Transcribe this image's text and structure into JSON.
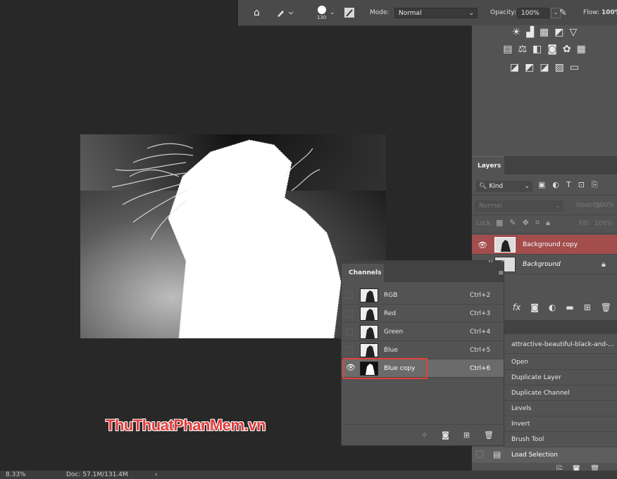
{
  "options_bar": {
    "brush_size": "130",
    "mode_label": "Mode:",
    "mode_value": "Normal",
    "opacity_label": "Opacity:",
    "opacity_value": "100%",
    "flow_label": "Flow:",
    "flow_value": "100%"
  },
  "layers": {
    "tab": "Layers",
    "filter_kind": "Kind",
    "blend_mode": "Normal",
    "opacity_label": "Opacity:",
    "opacity_value": "100%",
    "lock_label": "Lock:",
    "fill_label": "Fill:",
    "fill_value": "100%",
    "items": [
      {
        "name": "Background copy"
      },
      {
        "name": "Background"
      }
    ]
  },
  "channels": {
    "title": "Channels",
    "items": [
      {
        "name": "RGB",
        "shortcut": "Ctrl+2"
      },
      {
        "name": "Red",
        "shortcut": "Ctrl+3"
      },
      {
        "name": "Green",
        "shortcut": "Ctrl+4"
      },
      {
        "name": "Blue",
        "shortcut": "Ctrl+5"
      },
      {
        "name": "Blue copy",
        "shortcut": "Ctrl+6"
      }
    ]
  },
  "history": {
    "snapshot": "attractive-beautiful-black-and-...",
    "items": [
      "Open",
      "Duplicate Layer",
      "Duplicate Channel",
      "Levels",
      "Invert",
      "Brush Tool",
      "Load Selection"
    ]
  },
  "watermark": "ThuThuatPhanMem.vn",
  "status": {
    "zoom": "8.33%",
    "doc": "Doc: 57.1M/131.4M"
  },
  "colors": {
    "highlight": "#e0413a",
    "selected_layer": "#a34d4d",
    "panel": "#535353"
  }
}
